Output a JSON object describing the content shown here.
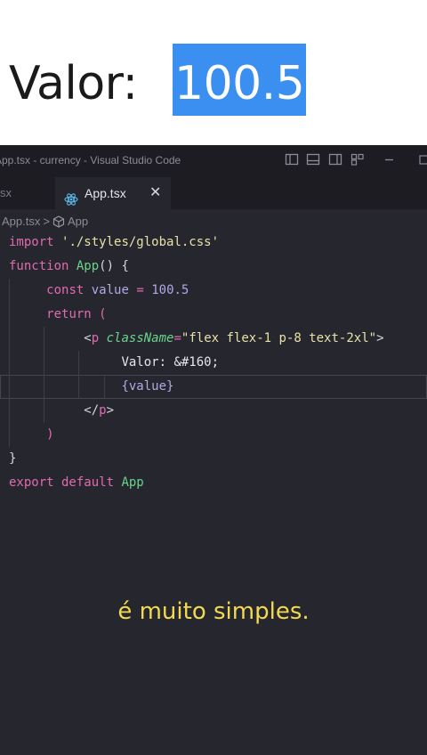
{
  "preview": {
    "label": "Valor:",
    "value": "100.5"
  },
  "window": {
    "title": "App.tsx - currency - Visual Studio Code"
  },
  "tabs": {
    "previous_label": "sx",
    "active_label": "App.tsx",
    "close_glyph": "✕"
  },
  "breadcrumb": {
    "file": "App.tsx",
    "separator": ">",
    "symbol": "App"
  },
  "code": {
    "l1_kw": "import",
    "l1_str": "'./styles/global.css'",
    "l2_kw": "function",
    "l2_fn": "App",
    "l2_rest": "() {",
    "l3_kw": "const",
    "l3_var": "value",
    "l3_eq": "=",
    "l3_num": "100.5",
    "l4_kw": "return",
    "l4_paren": "(",
    "l5_open": "<",
    "l5_tag": "p",
    "l5_attr": "className",
    "l5_eq": "=",
    "l5_str": "\"flex flex-1 p-8 text-2xl\"",
    "l5_close": ">",
    "l6_text": "Valor: &#160;",
    "l7_open": "{",
    "l7_var": "value",
    "l7_close": "}",
    "l8_open": "</",
    "l8_tag": "p",
    "l8_close": ">",
    "l9_paren": ")",
    "l10_brace": "}",
    "l11_kw": "export default",
    "l11_fn": "App"
  },
  "subtitle": "é muito simples.",
  "colors": {
    "highlight": "#3a8ff0",
    "editor_bg": "#26262f",
    "keyword": "#e06bb0",
    "function": "#6bd48c",
    "subtitle": "#f2d94e"
  },
  "icons": [
    "layout-sidebar-icon",
    "layout-panel-icon",
    "layout-split-icon",
    "layout-grid-icon",
    "minimize-icon",
    "react-icon",
    "symbol-cube-icon"
  ]
}
